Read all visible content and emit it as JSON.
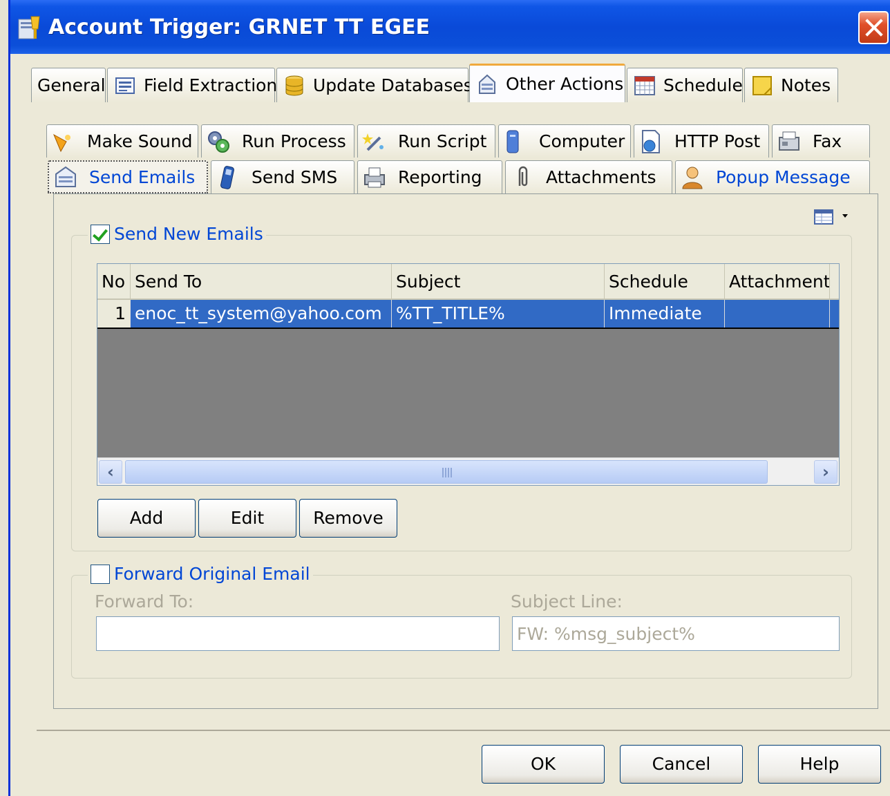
{
  "window": {
    "title": "Account Trigger: GRNET TT EGEE"
  },
  "main_tabs": [
    {
      "label": "General",
      "icon": ""
    },
    {
      "label": "Field Extraction",
      "icon": "form-icon"
    },
    {
      "label": "Update Databases",
      "icon": "database-icon"
    },
    {
      "label": "Other Actions",
      "icon": "mail-gear-icon"
    },
    {
      "label": "Schedule",
      "icon": "calendar-icon"
    },
    {
      "label": "Notes",
      "icon": "note-icon"
    }
  ],
  "action_tabs_row1": [
    {
      "label": "Make Sound",
      "icon": "speaker-icon"
    },
    {
      "label": "Run Process",
      "icon": "gears-icon"
    },
    {
      "label": "Run Script",
      "icon": "wand-icon"
    },
    {
      "label": "Computer",
      "icon": "computer-icon"
    },
    {
      "label": "HTTP Post",
      "icon": "document-globe-icon"
    },
    {
      "label": "Fax",
      "icon": "fax-icon"
    }
  ],
  "action_tabs_row2": [
    {
      "label": "Send Emails",
      "icon": "mail-icon"
    },
    {
      "label": "Send SMS",
      "icon": "phone-icon"
    },
    {
      "label": "Reporting",
      "icon": "printer-icon"
    },
    {
      "label": "Attachments",
      "icon": "paperclip-icon"
    },
    {
      "label": "Popup Message",
      "icon": "person-icon"
    }
  ],
  "send_new_emails": {
    "label": "Send New Emails",
    "checked": true,
    "columns": [
      "No",
      "Send To",
      "Subject",
      "Schedule",
      "Attachments"
    ],
    "rows": [
      {
        "no": "1",
        "send_to": "enoc_tt_system@yahoo.com",
        "subject": "%TT_TITLE%",
        "schedule": "Immediate",
        "attachments": ""
      }
    ],
    "buttons": {
      "add": "Add",
      "edit": "Edit",
      "remove": "Remove"
    }
  },
  "forward_original": {
    "label": "Forward Original Email",
    "checked": false,
    "forward_to_label": "Forward To:",
    "forward_to_value": "",
    "subject_line_label": "Subject Line:",
    "subject_line_value": "FW: %msg_subject%"
  },
  "dialog_buttons": {
    "ok": "OK",
    "cancel": "Cancel",
    "help": "Help"
  },
  "colors": {
    "title_bar": "#0a4ad8",
    "selection": "#316ac5",
    "accent_blue": "#0046d5",
    "tab_highlight": "#f0a93c"
  }
}
